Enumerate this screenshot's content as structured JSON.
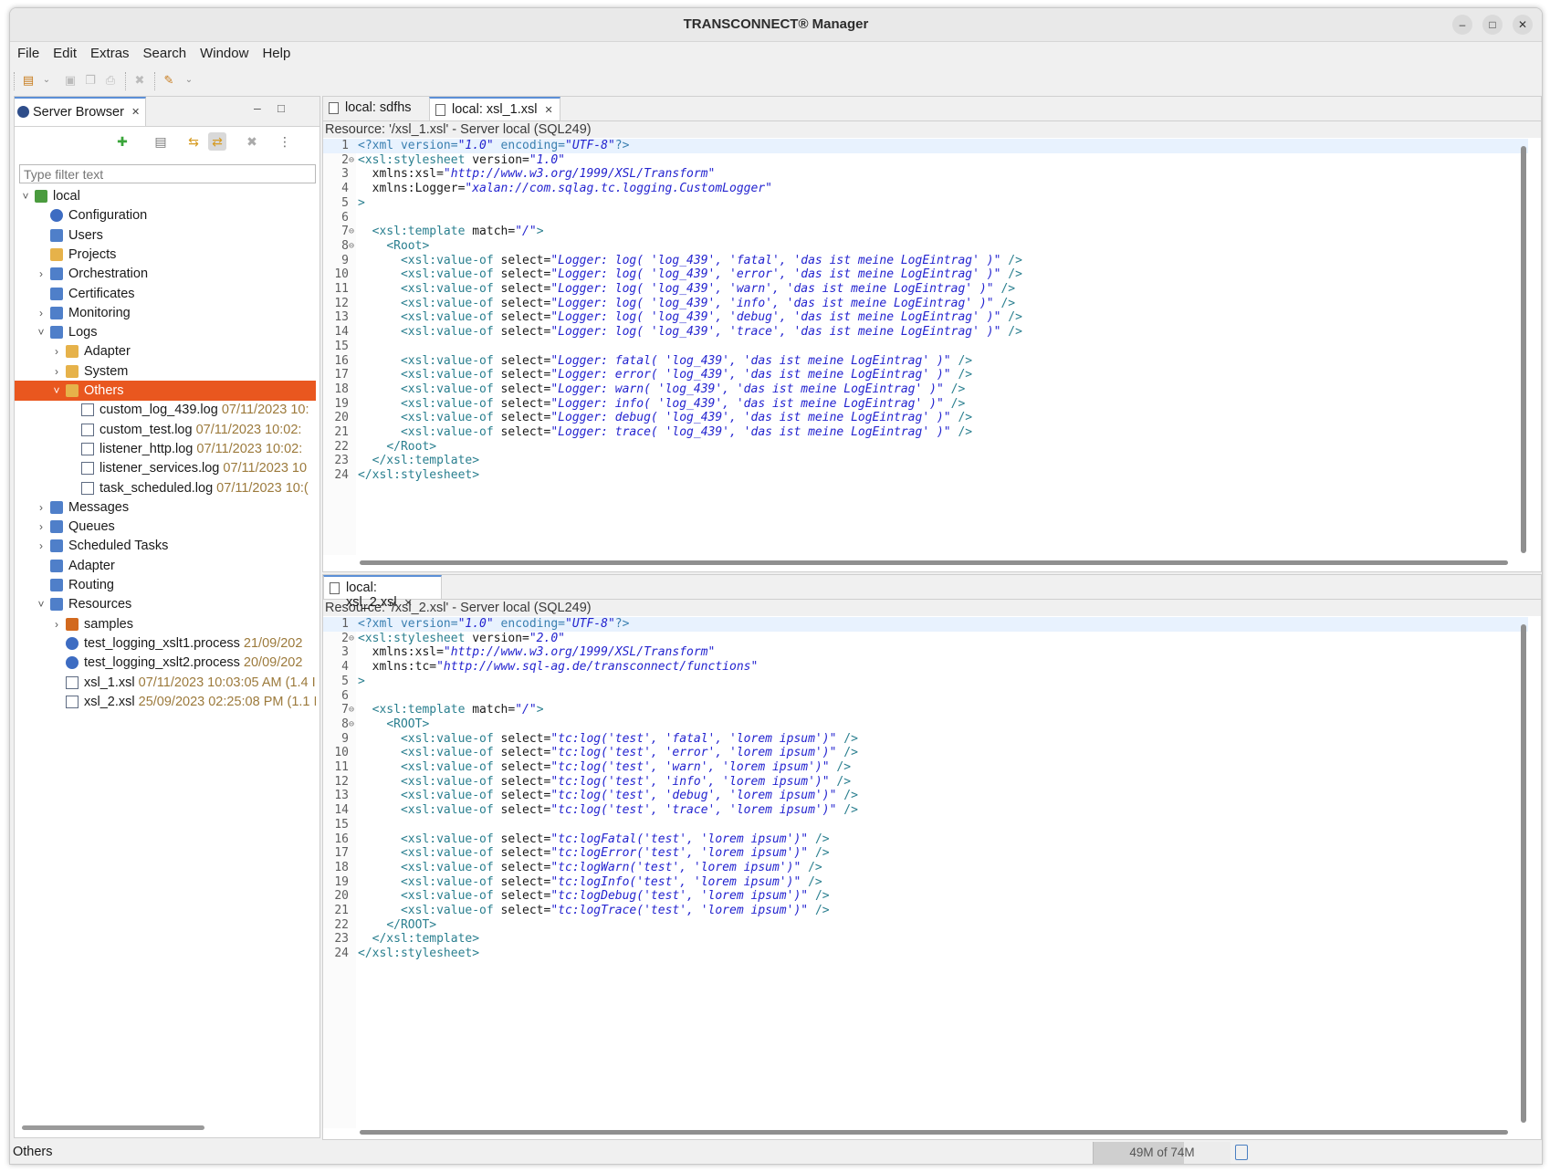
{
  "app": {
    "title": "TRANSCONNECT® Manager"
  },
  "menu": [
    "File",
    "Edit",
    "Extras",
    "Search",
    "Window",
    "Help"
  ],
  "server_browser": {
    "tab_label": "Server Browser",
    "filter_placeholder": "Type filter text",
    "tree": [
      {
        "label": "local",
        "date": "",
        "icon": "server-icon",
        "level": 0,
        "expanded": true
      },
      {
        "label": "Configuration",
        "date": "",
        "icon": "configuration-icon",
        "level": 1
      },
      {
        "label": "Users",
        "date": "",
        "icon": "users-icon",
        "level": 1
      },
      {
        "label": "Projects",
        "date": "",
        "icon": "folder-icon",
        "level": 1
      },
      {
        "label": "Orchestration",
        "date": "",
        "icon": "orchestration-icon",
        "level": 1,
        "collapsed": true
      },
      {
        "label": "Certificates",
        "date": "",
        "icon": "certificate-icon",
        "level": 1
      },
      {
        "label": "Monitoring",
        "date": "",
        "icon": "monitor-icon",
        "level": 1,
        "collapsed": true
      },
      {
        "label": "Logs",
        "date": "",
        "icon": "logs-icon",
        "level": 1,
        "expanded": true
      },
      {
        "label": "Adapter",
        "date": "",
        "icon": "folder-icon",
        "level": 2,
        "collapsed": true
      },
      {
        "label": "System",
        "date": "",
        "icon": "folder-icon",
        "level": 2,
        "collapsed": true
      },
      {
        "label": "Others",
        "date": "",
        "icon": "folder-icon",
        "level": 2,
        "expanded": true,
        "selected": true
      },
      {
        "label": "custom_log_439.log",
        "date": "07/11/2023 10:",
        "icon": "log-file-icon",
        "level": 3
      },
      {
        "label": "custom_test.log",
        "date": "07/11/2023 10:02:",
        "icon": "log-file-icon",
        "level": 3
      },
      {
        "label": "listener_http.log",
        "date": "07/11/2023 10:02:",
        "icon": "log-file-icon",
        "level": 3
      },
      {
        "label": "listener_services.log",
        "date": "07/11/2023 10",
        "icon": "log-file-icon",
        "level": 3
      },
      {
        "label": "task_scheduled.log",
        "date": "07/11/2023 10:(",
        "icon": "log-file-icon",
        "level": 3
      },
      {
        "label": "Messages",
        "date": "",
        "icon": "messages-icon",
        "level": 1,
        "collapsed": true
      },
      {
        "label": "Queues",
        "date": "",
        "icon": "queues-icon",
        "level": 1,
        "collapsed": true
      },
      {
        "label": "Scheduled Tasks",
        "date": "",
        "icon": "clock-icon",
        "level": 1,
        "collapsed": true
      },
      {
        "label": "Adapter",
        "date": "",
        "icon": "adapter-icon",
        "level": 1
      },
      {
        "label": "Routing",
        "date": "",
        "icon": "routing-icon",
        "level": 1
      },
      {
        "label": "Resources",
        "date": "",
        "icon": "resources-icon",
        "level": 1,
        "expanded": true
      },
      {
        "label": "samples",
        "date": "",
        "icon": "grid-icon",
        "level": 2,
        "collapsed": true
      },
      {
        "label": "test_logging_xslt1.process",
        "date": "21/09/202",
        "icon": "process-icon",
        "level": 2
      },
      {
        "label": "test_logging_xslt2.process",
        "date": "20/09/202",
        "icon": "process-icon",
        "level": 2
      },
      {
        "label": "xsl_1.xsl",
        "date": "07/11/2023 10:03:05 AM (1.4 I",
        "icon": "xsl-file-icon",
        "level": 2
      },
      {
        "label": "xsl_2.xsl",
        "date": "25/09/2023 02:25:08 PM (1.1 I",
        "icon": "xsl-file-icon",
        "level": 2
      }
    ]
  },
  "editor_top": {
    "tabs": [
      "local: sdfhs",
      "local: xsl_1.xsl"
    ],
    "resource": "Resource: '/xsl_1.xsl' - Server local (SQL249)",
    "lines": [
      "<?xml version=\"1.0\" encoding=\"UTF-8\"?>",
      "<xsl:stylesheet version=\"1.0\"",
      "  xmlns:xsl=\"http://www.w3.org/1999/XSL/Transform\"",
      "  xmlns:Logger=\"xalan://com.sqlag.tc.logging.CustomLogger\"",
      ">",
      "",
      "  <xsl:template match=\"/\">",
      "    <Root>",
      "      <xsl:value-of select=\"Logger: log( 'log_439', 'fatal', 'das ist meine LogEintrag' )\" />",
      "      <xsl:value-of select=\"Logger: log( 'log_439', 'error', 'das ist meine LogEintrag' )\" />",
      "      <xsl:value-of select=\"Logger: log( 'log_439', 'warn', 'das ist meine LogEintrag' )\" />",
      "      <xsl:value-of select=\"Logger: log( 'log_439', 'info', 'das ist meine LogEintrag' )\" />",
      "      <xsl:value-of select=\"Logger: log( 'log_439', 'debug', 'das ist meine LogEintrag' )\" />",
      "      <xsl:value-of select=\"Logger: log( 'log_439', 'trace', 'das ist meine LogEintrag' )\" />",
      "",
      "      <xsl:value-of select=\"Logger: fatal( 'log_439', 'das ist meine LogEintrag' )\" />",
      "      <xsl:value-of select=\"Logger: error( 'log_439', 'das ist meine LogEintrag' )\" />",
      "      <xsl:value-of select=\"Logger: warn( 'log_439', 'das ist meine LogEintrag' )\" />",
      "      <xsl:value-of select=\"Logger: info( 'log_439', 'das ist meine LogEintrag' )\" />",
      "      <xsl:value-of select=\"Logger: debug( 'log_439', 'das ist meine LogEintrag' )\" />",
      "      <xsl:value-of select=\"Logger: trace( 'log_439', 'das ist meine LogEintrag' )\" />",
      "    </Root>",
      "  </xsl:template>",
      "</xsl:stylesheet>"
    ]
  },
  "editor_bottom": {
    "tabs": [
      "local: xsl_2.xsl"
    ],
    "resource": "Resource: '/xsl_2.xsl' - Server local (SQL249)",
    "lines": [
      "<?xml version=\"1.0\" encoding=\"UTF-8\"?>",
      "<xsl:stylesheet version=\"2.0\"",
      "  xmlns:xsl=\"http://www.w3.org/1999/XSL/Transform\"",
      "  xmlns:tc=\"http://www.sql-ag.de/transconnect/functions\"",
      ">",
      "",
      "  <xsl:template match=\"/\">",
      "    <ROOT>",
      "      <xsl:value-of select=\"tc:log('test', 'fatal', 'lorem ipsum')\" />",
      "      <xsl:value-of select=\"tc:log('test', 'error', 'lorem ipsum')\" />",
      "      <xsl:value-of select=\"tc:log('test', 'warn', 'lorem ipsum')\" />",
      "      <xsl:value-of select=\"tc:log('test', 'info', 'lorem ipsum')\" />",
      "      <xsl:value-of select=\"tc:log('test', 'debug', 'lorem ipsum')\" />",
      "      <xsl:value-of select=\"tc:log('test', 'trace', 'lorem ipsum')\" />",
      "",
      "      <xsl:value-of select=\"tc:logFatal('test', 'lorem ipsum')\" />",
      "      <xsl:value-of select=\"tc:logError('test', 'lorem ipsum')\" />",
      "      <xsl:value-of select=\"tc:logWarn('test', 'lorem ipsum')\" />",
      "      <xsl:value-of select=\"tc:logInfo('test', 'lorem ipsum')\" />",
      "      <xsl:value-of select=\"tc:logDebug('test', 'lorem ipsum')\" />",
      "      <xsl:value-of select=\"tc:logTrace('test', 'lorem ipsum')\" />",
      "    </ROOT>",
      "  </xsl:template>",
      "</xsl:stylesheet>"
    ]
  },
  "status": {
    "text": "Others",
    "heap": "49M of 74M",
    "heap_used_fraction": 0.66
  }
}
